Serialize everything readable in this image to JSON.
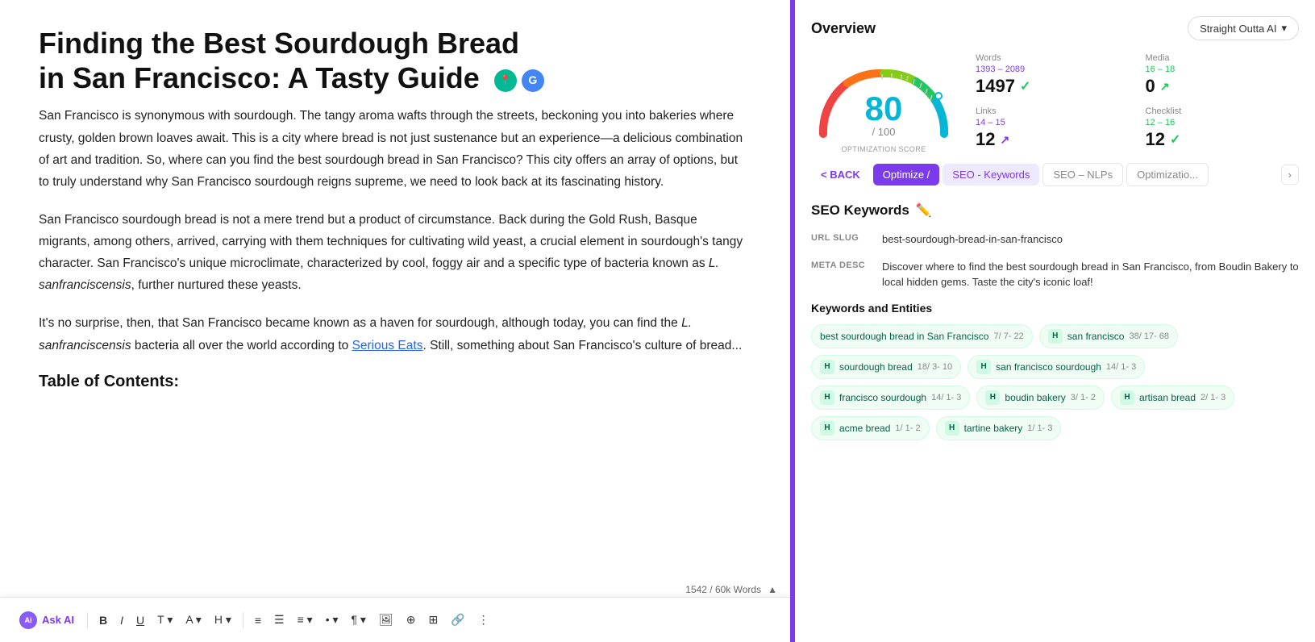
{
  "editor": {
    "title_line1": "Finding the Best Sourdough Bread",
    "title_line2": "in San Francisco: A Tasty Guide",
    "paragraphs": [
      "San Francisco is synonymous with sourdough. The tangy aroma wafts through the streets, beckoning you into bakeries where crusty, golden brown loaves await. This is a city where bread is not just sustenance but an experience—a delicious combination of art and tradition. So, where can you find the best sourdough bread in San Francisco? This city offers an array of options, but to truly understand why San Francisco sourdough reigns supreme, we need to look back at its fascinating history.",
      "San Francisco sourdough bread is not a mere trend but a product of circumstance. Back during the Gold Rush, Basque migrants, among others, arrived, carrying with them techniques for cultivating wild yeast, a crucial element in sourdough's tangy character. San Francisco's unique microclimate, characterized by cool, foggy air and a specific type of bacteria known as L. sanfranciscensis, further nurtured these yeasts.",
      "It's no surprise, then, that San Francisco became known as a haven for sourdough, although today, you can find the L. sanfranciscensis bacteria all over the world according to Serious Eats. Still, something about San Francisco's culture of bread..."
    ],
    "word_count": "1542 / 60k Words",
    "table_of_contents": "Table of Contents:",
    "toolbar": {
      "ask_ai": "Ask AI",
      "ai_label": "Ai"
    }
  },
  "overview": {
    "title": "Overview",
    "dropdown_label": "Straight Outta AI",
    "stats": {
      "words_label": "Words",
      "words_range": "1393 – 2089",
      "words_value": "1497",
      "media_label": "Media",
      "media_range": "16 – 18",
      "media_value": "0",
      "links_label": "Links",
      "links_range": "14 – 15",
      "links_value": "12",
      "checklist_label": "Checklist",
      "checklist_range": "12 – 16",
      "checklist_value": "12"
    },
    "gauge": {
      "score": "80",
      "denom": "/ 100",
      "label": "OPTIMIZATION SCORE"
    }
  },
  "tabs": {
    "back": "< BACK",
    "optimize": "Optimize /",
    "seo_keywords": "SEO - Keywords",
    "seo_nlps": "SEO – NLPs",
    "optimization": "Optimizatio..."
  },
  "seo_keywords": {
    "title": "SEO Keywords",
    "url_slug_label": "URL SLUG",
    "url_slug_value": "best-sourdough-bread-in-san-francisco",
    "meta_desc_label": "META DESC",
    "meta_desc_value": "Discover where to find the best sourdough bread in San Francisco, from Boudin Bakery to local hidden gems. Taste the city's iconic loaf!",
    "keywords_title": "Keywords and Entities",
    "keywords": [
      {
        "text": "best sourdough bread in San Francisco",
        "nums": "7/ 7- 22",
        "type": "green",
        "has_h": false
      },
      {
        "text": "san francisco",
        "nums": "38/ 17- 68",
        "type": "green",
        "has_h": true
      },
      {
        "text": "sourdough bread",
        "nums": "18/ 3- 10",
        "type": "green",
        "has_h": true
      },
      {
        "text": "san francisco sourdough",
        "nums": "14/ 1- 3",
        "type": "green",
        "has_h": true
      },
      {
        "text": "francisco sourdough",
        "nums": "14/ 1- 3",
        "type": "green",
        "has_h": true
      },
      {
        "text": "boudin bakery",
        "nums": "3/ 1- 2",
        "type": "green",
        "has_h": true
      },
      {
        "text": "artisan bread",
        "nums": "2/ 1- 3",
        "type": "green",
        "has_h": true
      },
      {
        "text": "acme bread",
        "nums": "1/ 1- 2",
        "type": "green",
        "has_h": true
      },
      {
        "text": "tartine bakery",
        "nums": "1/ 1- 3",
        "type": "green",
        "has_h": true
      }
    ]
  }
}
